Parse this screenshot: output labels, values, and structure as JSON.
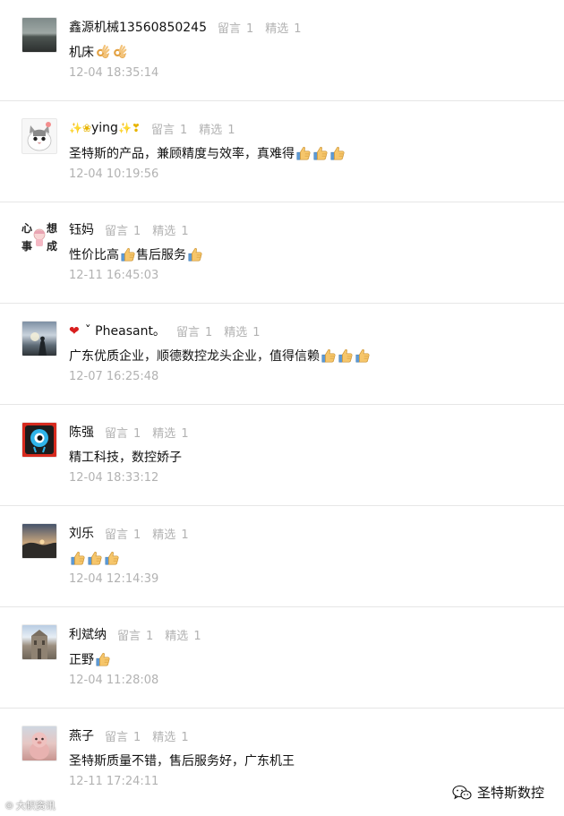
{
  "comments": [
    {
      "username": "鑫源机械13560850245",
      "leave_label": "留言",
      "leave_count": "1",
      "selected_label": "精选",
      "selected_count": "1",
      "text": "机床",
      "emoji": [
        "ok-hand-icon",
        "ok-hand-icon"
      ],
      "timestamp": "12-04 18:35:14"
    },
    {
      "username": "ying",
      "username_decor": "✨❀ying✨❣",
      "leave_label": "留言",
      "leave_count": "1",
      "selected_label": "精选",
      "selected_count": "1",
      "text": "圣特斯的产品，兼顾精度与效率，真难得",
      "emoji": [
        "thumbs-up-icon",
        "thumbs-up-icon",
        "thumbs-up-icon"
      ],
      "timestamp": "12-04 10:19:56"
    },
    {
      "username": "钰妈",
      "avatar_text": [
        "心",
        "想",
        "事",
        "成"
      ],
      "leave_label": "留言",
      "leave_count": "1",
      "selected_label": "精选",
      "selected_count": "1",
      "text_parts": [
        "性价比高",
        "售后服务"
      ],
      "emoji": [
        "thumbs-up-icon",
        "thumbs-up-icon"
      ],
      "timestamp": "12-11 16:45:03"
    },
    {
      "username": "ˇ Pheasant。",
      "leave_label": "留言",
      "leave_count": "1",
      "selected_label": "精选",
      "selected_count": "1",
      "text": "广东优质企业，顺德数控龙头企业，值得信赖",
      "emoji": [
        "thumbs-up-icon",
        "thumbs-up-icon",
        "thumbs-up-icon"
      ],
      "timestamp": "12-07 16:25:48"
    },
    {
      "username": "陈强",
      "leave_label": "留言",
      "leave_count": "1",
      "selected_label": "精选",
      "selected_count": "1",
      "text": "精工科技，数控娇子",
      "emoji": [],
      "timestamp": "12-04 18:33:12"
    },
    {
      "username": "刘乐",
      "leave_label": "留言",
      "leave_count": "1",
      "selected_label": "精选",
      "selected_count": "1",
      "text": "",
      "emoji": [
        "thumbs-up-icon",
        "thumbs-up-icon",
        "thumbs-up-icon"
      ],
      "timestamp": "12-04 12:14:39"
    },
    {
      "username": "利斌纳",
      "leave_label": "留言",
      "leave_count": "1",
      "selected_label": "精选",
      "selected_count": "1",
      "text": "正野",
      "emoji": [
        "thumbs-up-icon"
      ],
      "timestamp": "12-04 11:28:08"
    },
    {
      "username": "燕子",
      "leave_label": "留言",
      "leave_count": "1",
      "selected_label": "精选",
      "selected_count": "1",
      "text": "圣特斯质量不错，售后服务好，广东机王",
      "emoji": [],
      "timestamp": "12-11 17:24:11"
    }
  ],
  "footer": {
    "watermark": "大帜资讯",
    "brand": "圣特斯数控",
    "brand_icon": "wechat-icon"
  },
  "colors": {
    "text": "#111111",
    "muted": "#b2b2b2",
    "divider": "#e6e6e6",
    "heart": "#d81e1e"
  }
}
